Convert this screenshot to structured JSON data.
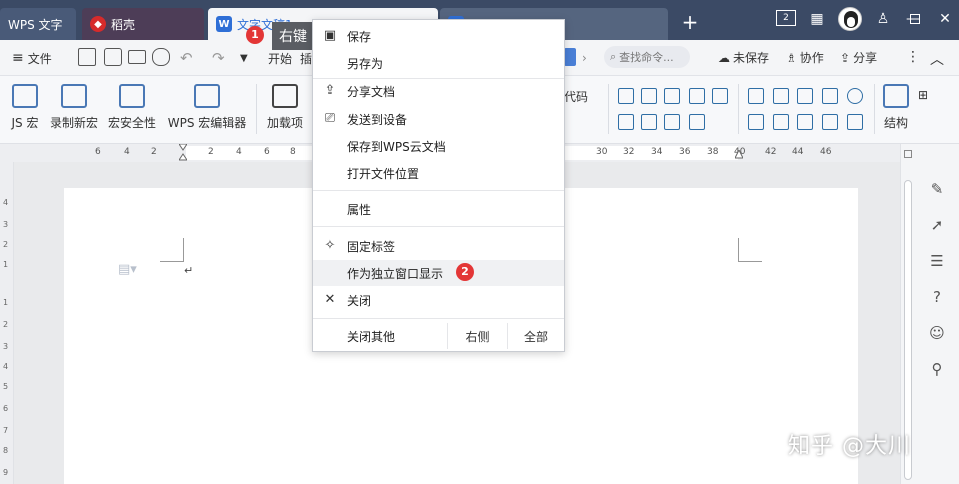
{
  "tabs": {
    "wps": "WPS 文字",
    "daoke": "稻壳",
    "doc": "文字文稿1",
    "new_tab_icon": "plus-icon"
  },
  "titlebar_icons": [
    "two-window-icon",
    "grid-icon",
    "shirt-icon",
    "minimize-icon",
    "maximize-icon",
    "close-icon"
  ],
  "menubar": {
    "file": "文件",
    "start": "开始",
    "insert": "插",
    "search_placeholder": "查找命令...",
    "unsaved": "未保存",
    "collab": "协作",
    "share": "分享"
  },
  "ribbon": {
    "js_macro": "JS 宏",
    "record_macro": "录制新宏",
    "macro_security": "宏安全性",
    "wps_macro_editor": "WPS 宏编辑器",
    "addins": "加载项",
    "code": "代码",
    "structure": "结构"
  },
  "ruler": {
    "left_nums": [
      "6",
      "4",
      "2",
      "2",
      "4",
      "6",
      "8"
    ],
    "right_nums": [
      "30",
      "32",
      "34",
      "36",
      "38",
      "40",
      "42",
      "44",
      "46"
    ],
    "v_nums": [
      "4",
      "3",
      "2",
      "1",
      "1",
      "2",
      "3",
      "4",
      "5",
      "6",
      "7",
      "8",
      "9"
    ]
  },
  "tip": {
    "right_click": "右键",
    "step1": "1",
    "step2": "2"
  },
  "context_menu": {
    "save": "保存",
    "save_as": "另存为",
    "share_doc": "分享文档",
    "send_device": "发送到设备",
    "save_cloud": "保存到WPS云文档",
    "open_location": "打开文件位置",
    "properties": "属性",
    "pin_tab": "固定标签",
    "separate_window": "作为独立窗口显示",
    "close": "关闭",
    "close_others": "关闭其他",
    "right_side": "右侧",
    "all": "全部"
  },
  "watermark": "知乎 @大川"
}
